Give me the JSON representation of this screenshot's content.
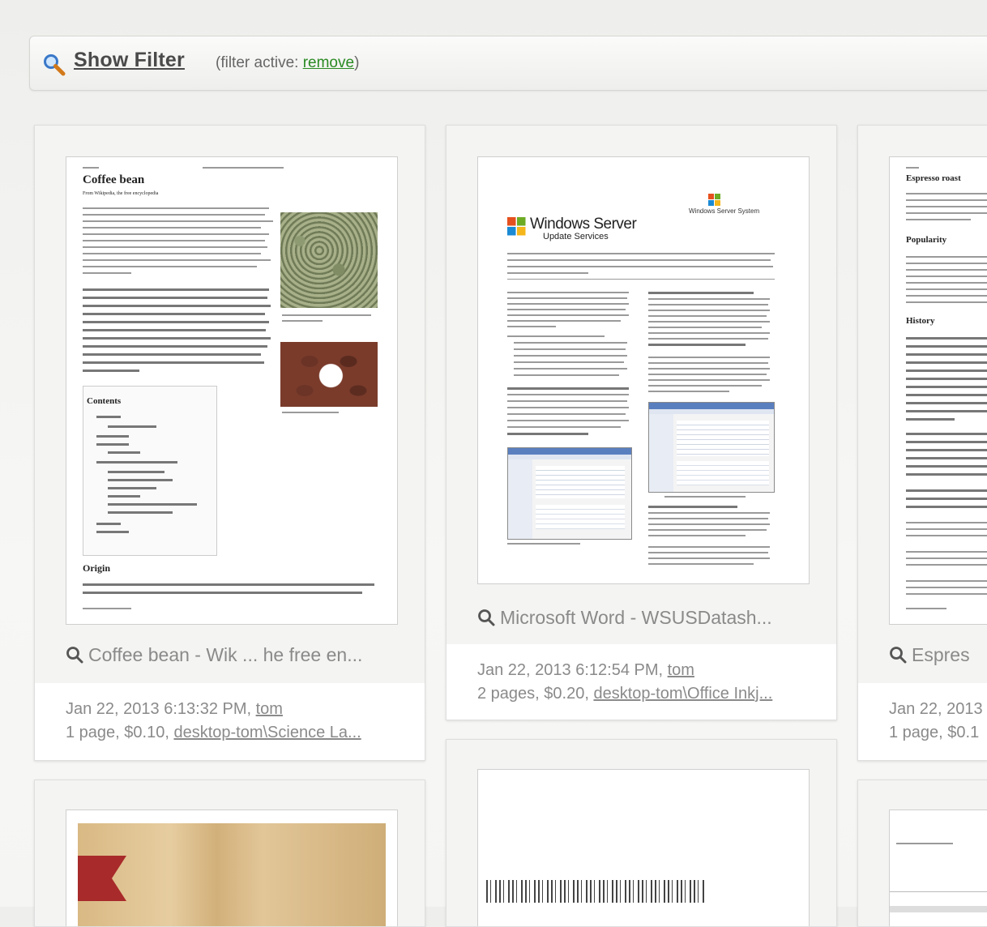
{
  "filter": {
    "show_label": "Show Filter",
    "active_prefix": "(filter active: ",
    "remove_label": "remove",
    "active_suffix": ")"
  },
  "jobs": [
    {
      "caption": "Coffee bean - Wik ... he free en...",
      "date": "Jan 22, 2013 6:13:32 PM, ",
      "user": "tom",
      "summary": "1 page, $0.10, ",
      "printer": "desktop-tom\\Science La...",
      "thumb": {
        "title": "Coffee bean",
        "subtitle": "From Wikipedia, the free encyclopedia",
        "contents": "Contents",
        "origin": "Origin"
      }
    },
    {
      "caption": "Microsoft Word - WSUSDatash...",
      "date": "Jan 22, 2013 6:12:54 PM, ",
      "user": "tom",
      "summary": "2 pages, $0.20, ",
      "printer": "desktop-tom\\Office Inkj...",
      "thumb": {
        "logo_main": "Windows Server",
        "logo_sub": "Update Services",
        "logo_small": "Windows Server System"
      }
    },
    {
      "caption": "Espres",
      "date": "Jan 22, 2013",
      "summary": "1 page, $0.1",
      "thumb": {
        "title": "Espresso roast",
        "popularity": "Popularity",
        "history": "History"
      }
    }
  ],
  "colors": {
    "link_green": "#2a8a22",
    "meta_grey": "#8a8a8a",
    "ribbon_red": "#a82a2a"
  }
}
